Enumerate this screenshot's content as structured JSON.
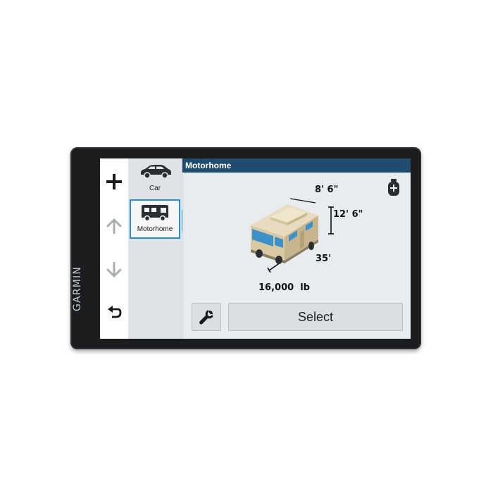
{
  "device": {
    "brand": "GARMIN"
  },
  "nav": {
    "icons": [
      "plus-icon",
      "arrow-up-icon",
      "arrow-down-icon",
      "back-icon"
    ]
  },
  "vehicles": [
    {
      "label": "Car",
      "icon": "car-icon",
      "selected": false
    },
    {
      "label": "Motorhome",
      "icon": "motorhome-icon",
      "selected": true
    }
  ],
  "main": {
    "title": "Motorhome",
    "propane_icon": "propane-tank-icon",
    "width": "8' 6\"",
    "height": "12' 6\"",
    "length": "35'",
    "weight": "16,000  lb",
    "select_label": "Select",
    "settings_icon": "wrench-icon"
  },
  "colors": {
    "titlebar": "#1f4b6e",
    "selection": "#2a8fd0",
    "bezel": "#1b1c1e"
  }
}
